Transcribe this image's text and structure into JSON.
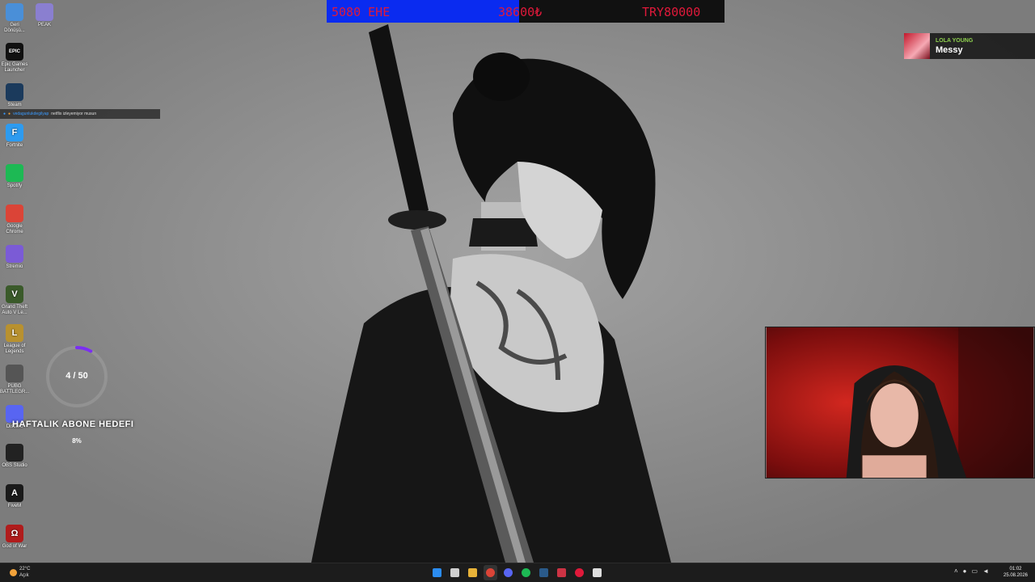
{
  "desktop_icons": [
    {
      "label": "Geri Dönüşü...",
      "icon": "recycle-bin-icon",
      "color": "#4a8fd8"
    },
    {
      "label": "PEAK",
      "icon": "peak-game-icon",
      "color": "#8a7fd0"
    },
    {
      "label": "Epic Games Launcher",
      "icon": "epic-games-icon",
      "color": "#111111",
      "glyph": "EPIC"
    },
    {
      "label": "Steam",
      "icon": "steam-icon",
      "color": "#1b3a5c"
    },
    {
      "label": "Fortnite",
      "icon": "fortnite-icon",
      "color": "#2d9bf0",
      "glyph": "F"
    },
    {
      "label": "Spotify",
      "icon": "spotify-icon",
      "color": "#1db954"
    },
    {
      "label": "Google Chrome",
      "icon": "chrome-icon",
      "color": "#db4437"
    },
    {
      "label": "Stremio",
      "icon": "stremio-icon",
      "color": "#7b5bd6"
    },
    {
      "label": "Grand Theft Auto V Le...",
      "icon": "gta-v-icon",
      "color": "#3a5a2a",
      "glyph": "V"
    },
    {
      "label": "League of Legends",
      "icon": "league-of-legends-icon",
      "color": "#b8912f",
      "glyph": "L"
    },
    {
      "label": "PUBG BATTLEGR...",
      "icon": "pubg-icon",
      "color": "#555555"
    },
    {
      "label": "Discord",
      "icon": "discord-icon",
      "color": "#5865f2"
    },
    {
      "label": "OBS Studio",
      "icon": "obs-icon",
      "color": "#222222"
    },
    {
      "label": "FiveM",
      "icon": "fivem-icon",
      "color": "#1a1a1a",
      "glyph": "A"
    },
    {
      "label": "God of War",
      "icon": "god-of-war-icon",
      "color": "#b01c1c",
      "glyph": "Ω"
    }
  ],
  "ticker": {
    "item1": "5080 EHE",
    "item2": "38600₺",
    "item3": "TRY80000",
    "text_color": "#e0193a",
    "highlight_color": "#0a2bf0"
  },
  "now_playing": {
    "artist": "LOLA YOUNG",
    "title": "Messy"
  },
  "chat": {
    "user": "vedagunlukdegilyap",
    "message": "netflix izleyemiyor musun"
  },
  "sub_goal": {
    "count": "4 / 50",
    "title": "HAFTALIK ABONE HEDEFI",
    "percent": "8%",
    "progress": 0.08,
    "ring_color": "#7b2ff2"
  },
  "taskbar": {
    "weather_temp": "22°C",
    "weather_desc": "Açık",
    "icons": [
      "windows-start-icon",
      "search-icon",
      "file-explorer-icon",
      "chrome-icon",
      "discord-icon",
      "spotify-icon",
      "steam-icon",
      "game-icon",
      "opera-icon",
      "app-icon"
    ],
    "time": "01:02",
    "date": "25.08.2026"
  }
}
